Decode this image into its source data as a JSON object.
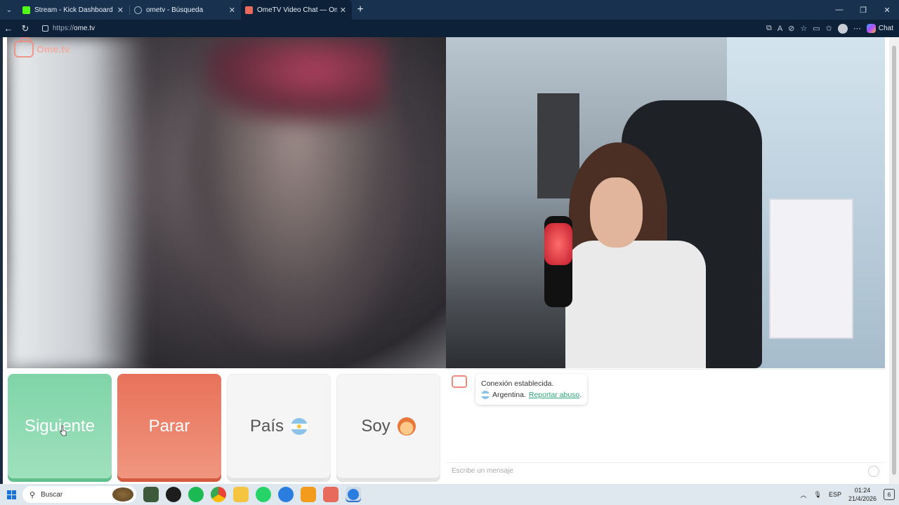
{
  "browser": {
    "tabs": [
      {
        "title": "Stream - Kick Dashboard",
        "favicon_color": "#53fc18"
      },
      {
        "title": "ometv - Búsqueda",
        "favicon_color": "#9fb0c2"
      },
      {
        "title": "OmeTV Video Chat — Omegle",
        "favicon_color": "#e86a5c"
      }
    ],
    "url_scheme": "https://",
    "url_host": "ome.tv",
    "copilot_label": "Chat"
  },
  "site": {
    "logo_text": "Ome.tv"
  },
  "buttons": {
    "next_label": "Siguiente",
    "stop_label": "Parar",
    "country_label": "País",
    "me_label": "Soy"
  },
  "chat": {
    "connection_text": "Conexión establecida.",
    "country_text": "Argentina.",
    "report_link": "Reportar abuso",
    "report_suffix": ".",
    "input_placeholder": "Escribe un mensaje"
  },
  "taskbar": {
    "search_placeholder": "Buscar",
    "language": "ESP",
    "time": "01:24",
    "date": "21/4/2026",
    "notification_count": "6"
  }
}
